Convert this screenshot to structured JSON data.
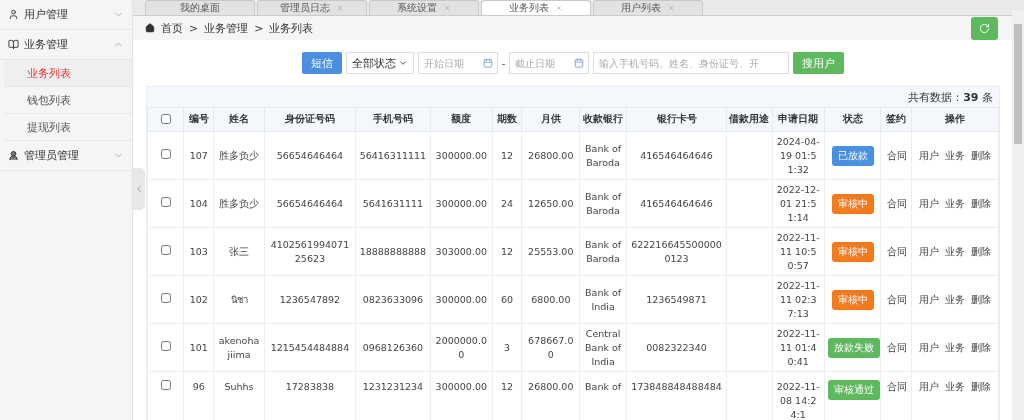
{
  "sidebar": {
    "groups": [
      {
        "label": "用户管理",
        "kind": "user",
        "expanded": false
      },
      {
        "label": "业务管理",
        "kind": "book",
        "expanded": true,
        "children": [
          {
            "label": "业务列表",
            "selected": true
          },
          {
            "label": "钱包列表",
            "selected": false
          },
          {
            "label": "提现列表",
            "selected": false
          }
        ]
      },
      {
        "label": "管理员管理",
        "kind": "admin",
        "expanded": false
      }
    ]
  },
  "tabs": [
    {
      "label": "我的桌面",
      "selected": false,
      "closable": false
    },
    {
      "label": "管理员日志",
      "selected": false,
      "closable": true
    },
    {
      "label": "系统设置",
      "selected": false,
      "closable": true
    },
    {
      "label": "业务列表",
      "selected": true,
      "closable": true
    },
    {
      "label": "用户列表",
      "selected": false,
      "closable": true
    }
  ],
  "breadcrumb": [
    "首页",
    ">",
    "业务管理",
    ">",
    "业务列表"
  ],
  "toolbar": {
    "sms_button": "短信",
    "status_select": "全部状态",
    "start_date": {
      "placeholder": "开始日期"
    },
    "separator": "-",
    "end_date": {
      "placeholder": "截止日期"
    },
    "search": {
      "placeholder": "输入手机号码、姓名、身份证号、开"
    },
    "search_button": "搜用户"
  },
  "table": {
    "count": "共有数据：**39** 条",
    "columns": [
      "编号",
      "姓名",
      "身份证号码",
      "手机号码",
      "额度",
      "期数",
      "月供",
      "收款银行",
      "银行卡号",
      "借款用途",
      "申请日期",
      "状态",
      "签约",
      "操作"
    ],
    "header_checked": false,
    "rows": [
      {
        "checked": false,
        "id": "107",
        "name": "胜多负少",
        "id_card": "56654646464",
        "phone": "56416311111",
        "amount": "300000.00",
        "term": "12",
        "monthly": "26800.00",
        "bank": "Bank of Baroda",
        "card": "416546464646",
        "date": "2024-04-19 01:51:32",
        "status": {
          "label": "已放款",
          "color": "#4a90e2"
        },
        "contract": "合同",
        "actions": [
          "用户",
          "业务",
          "删除"
        ]
      },
      {
        "checked": false,
        "id": "104",
        "name": "胜多负少",
        "id_card": "56654646464",
        "phone": "5641631111",
        "amount": "300000.00",
        "term": "24",
        "monthly": "12650.00",
        "bank": "Bank of Baroda",
        "card": "416546464646",
        "date": "2022-12-01 21:51:14",
        "status": {
          "label": "审核中",
          "color": "#f37b1d"
        },
        "contract": "合同",
        "actions": [
          "用户",
          "业务",
          "删除"
        ]
      },
      {
        "checked": false,
        "id": "103",
        "name": "张三",
        "id_card": "410256199407125623",
        "phone": "18888888888",
        "amount": "303000.00",
        "term": "12",
        "monthly": "25553.00",
        "bank": "Bank of Baroda",
        "card": "6222166455000000123",
        "date": "2022-11-11 10:50:57",
        "status": {
          "label": "审核中",
          "color": "#f37b1d"
        },
        "contract": "合同",
        "actions": [
          "用户",
          "业务",
          "删除"
        ]
      },
      {
        "checked": false,
        "id": "102",
        "name": "นิชา",
        "id_card": "1236547892",
        "phone": "0823633096",
        "amount": "300000.00",
        "term": "60",
        "monthly": "6800.00",
        "bank": "Bank of India",
        "card": "1236549871",
        "date": "2022-11-11 02:37:13",
        "status": {
          "label": "审核中",
          "color": "#f37b1d"
        },
        "contract": "合同",
        "actions": [
          "用户",
          "业务",
          "删除"
        ]
      },
      {
        "checked": false,
        "id": "101",
        "name": "akenoha jiima",
        "id_card": "1215454484884",
        "phone": "0968126360",
        "amount": "2000000.00",
        "term": "3",
        "monthly": "678667.00",
        "bank": "Central Bank of India",
        "card": "0082322340",
        "date": "2022-11-11 01:40:41",
        "status": {
          "label": "放款失败",
          "color": "#5eb95e"
        },
        "contract": "合同",
        "actions": [
          "用户",
          "业务",
          "删除"
        ]
      },
      {
        "checked": false,
        "id": "96",
        "name": "Suhhs",
        "id_card": "17283838",
        "phone": "1231231234",
        "amount": "300000.00",
        "term": "12",
        "monthly": "26800.00",
        "bank": "Bank of",
        "card": "173848848488484",
        "date": "2022-11-08 14:24:1",
        "status": {
          "label": "审核通过",
          "color": "#5eb95e"
        },
        "contract": "合同",
        "actions": [
          "用户",
          "业务",
          "删除"
        ]
      }
    ]
  }
}
